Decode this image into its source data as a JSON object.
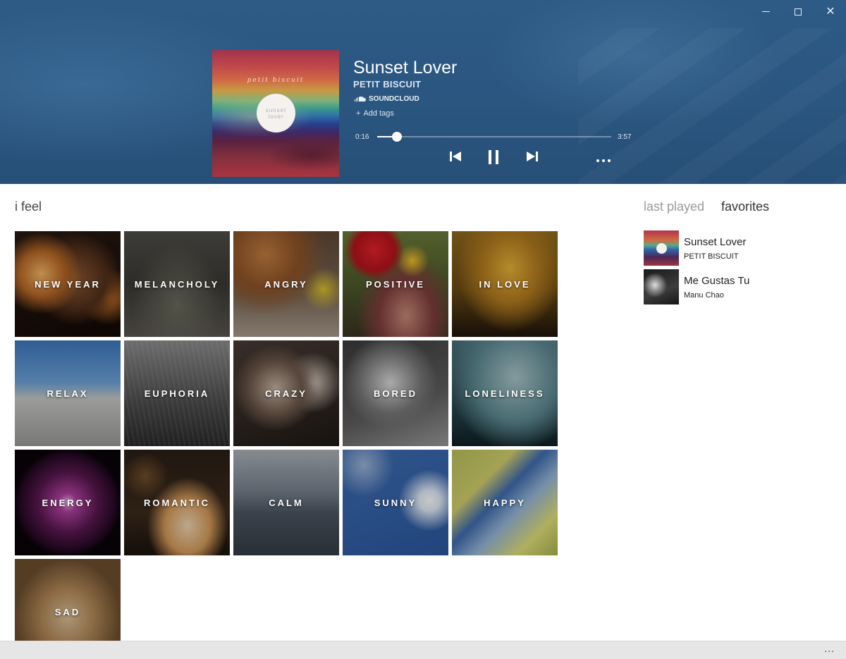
{
  "window": {
    "minimize_label": "Minimize",
    "maximize_label": "Maximize",
    "close_label": "Close"
  },
  "now_playing": {
    "album_art_script": "petit biscuit",
    "album_art_circle_text": "sunset lover",
    "title": "Sunset Lover",
    "artist": "PETIT BISCUIT",
    "source": "SOUNDCLOUD",
    "add_tags": "Add tags",
    "elapsed": "0:16",
    "total": "3:57",
    "progress_fraction": 0.085,
    "icons": {
      "source": "soundcloud-icon",
      "prev": "skip-previous-icon",
      "pause": "pause-icon",
      "next": "skip-next-icon",
      "more": "more-icon"
    }
  },
  "section_title": "i feel",
  "moods": [
    {
      "label": "NEW YEAR"
    },
    {
      "label": "MELANCHOLY"
    },
    {
      "label": "ANGRY"
    },
    {
      "label": "POSITIVE"
    },
    {
      "label": "IN LOVE"
    },
    {
      "label": "RELAX"
    },
    {
      "label": "EUPHORIA"
    },
    {
      "label": "CRAZY"
    },
    {
      "label": "BORED"
    },
    {
      "label": "LONELINESS"
    },
    {
      "label": "ENERGY"
    },
    {
      "label": "ROMANTIC"
    },
    {
      "label": "CALM"
    },
    {
      "label": "SUNNY"
    },
    {
      "label": "HAPPY"
    },
    {
      "label": "SAD"
    }
  ],
  "right_panel": {
    "tabs": [
      "last played",
      "favorites"
    ],
    "selected_tab": "favorites",
    "items": [
      {
        "title": "Sunset Lover",
        "artist": "PETIT BISCUIT"
      },
      {
        "title": "Me Gustas Tu",
        "artist": "Manu Chao"
      }
    ]
  },
  "bottom_bar": {
    "more_label": "..."
  },
  "colors": {
    "header_bg": "#2b5782",
    "accent_white": "#ffffff",
    "text_dark": "#333333",
    "tab_inactive": "#9a9a9a"
  }
}
